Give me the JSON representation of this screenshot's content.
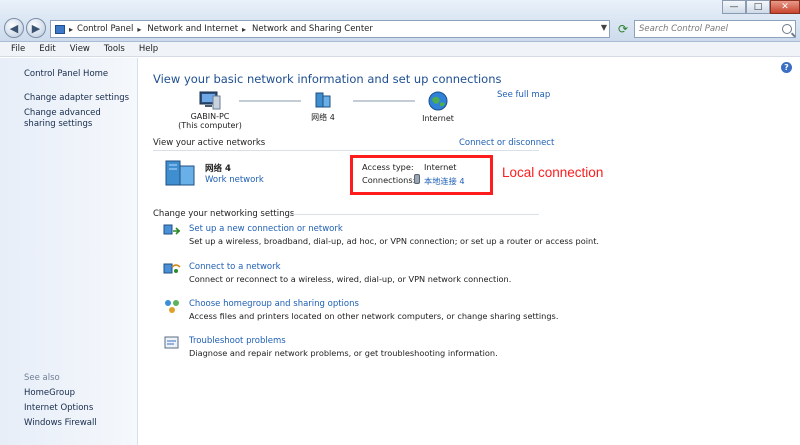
{
  "address": {
    "crumbs": [
      "Control Panel",
      "Network and Internet",
      "Network and Sharing Center"
    ],
    "search_placeholder": "Search Control Panel"
  },
  "menu": [
    "File",
    "Edit",
    "View",
    "Tools",
    "Help"
  ],
  "left_pane": {
    "home": "Control Panel Home",
    "links": [
      "Change adapter settings",
      "Change advanced sharing settings"
    ],
    "see_also_title": "See also",
    "see_also": [
      "HomeGroup",
      "Internet Options",
      "Windows Firewall"
    ]
  },
  "main": {
    "heading": "View your basic network information and set up connections",
    "see_full_map": "See full map",
    "map": {
      "computer_name": "GABIN-PC",
      "computer_sub": "(This computer)",
      "network": "网络 4",
      "internet": "Internet"
    },
    "active_networks_title": "View your active networks",
    "connect_disconnect": "Connect or disconnect",
    "active": {
      "name": "网络 4",
      "type": "Work network",
      "access_type_label": "Access type:",
      "access_type_value": "Internet",
      "connections_label": "Connections:",
      "connections_value": "本地连接 4"
    },
    "settings_title": "Change your networking settings",
    "tasks": [
      {
        "title": "Set up a new connection or network",
        "desc": "Set up a wireless, broadband, dial-up, ad hoc, or VPN connection; or set up a router or access point."
      },
      {
        "title": "Connect to a network",
        "desc": "Connect or reconnect to a wireless, wired, dial-up, or VPN network connection."
      },
      {
        "title": "Choose homegroup and sharing options",
        "desc": "Access files and printers located on other network computers, or change sharing settings."
      },
      {
        "title": "Troubleshoot problems",
        "desc": "Diagnose and repair network problems, or get troubleshooting information."
      }
    ]
  },
  "annotation": "Local connection",
  "colors": {
    "link": "#1e5fb4",
    "heading": "#1e4f91",
    "annotation": "#ff1c1c"
  }
}
